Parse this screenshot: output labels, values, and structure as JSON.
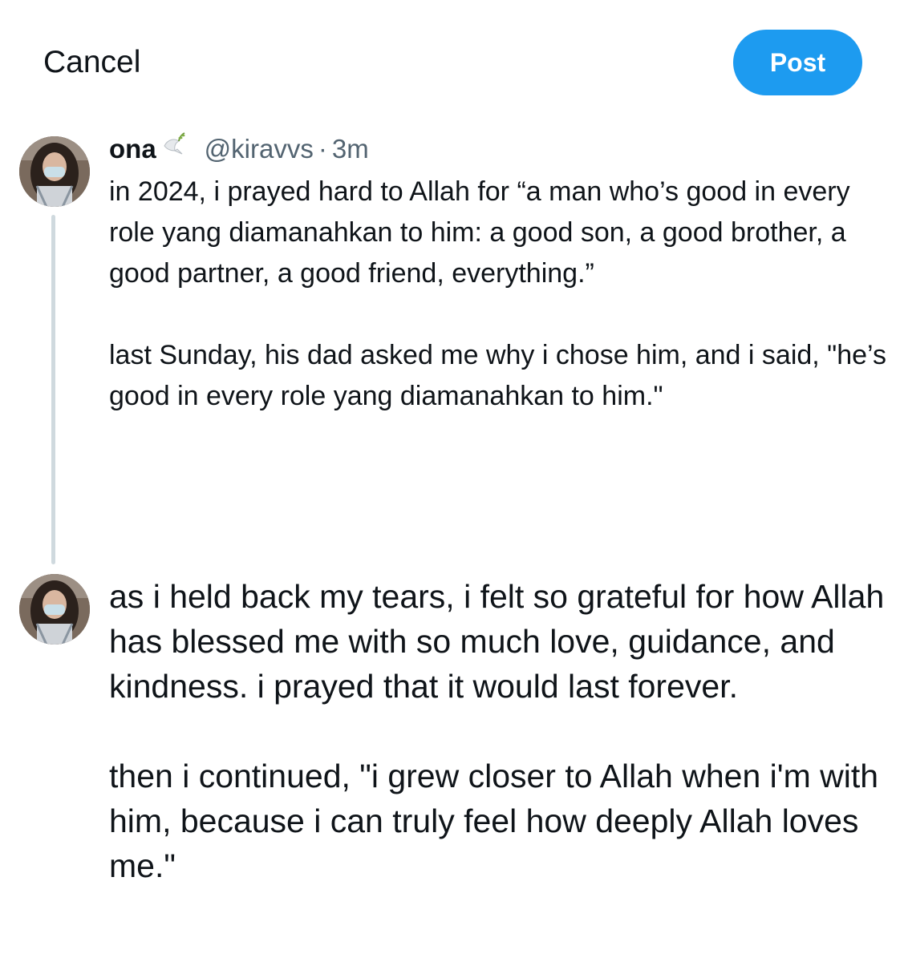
{
  "header": {
    "cancel_label": "Cancel",
    "post_label": "Post",
    "post_color": "#1d9bf0"
  },
  "thread": {
    "author": {
      "display_name": "ona",
      "emoji_icon": "dove-icon",
      "handle": "@kiravvs",
      "separator": "·",
      "time": "3m"
    },
    "tweets": [
      {
        "text": "in 2024, i prayed hard to Allah for “a man who’s good in every role yang diamanahkan to him: a good son, a good brother, a good partner, a good friend, everything.”\n\nlast Sunday, his dad asked me why i chose him, and i said, \"he’s good in every role yang diamanahkan to him.\""
      },
      {
        "text": "as i held back my tears, i felt so grateful for how Allah has blessed me with so much love, guidance, and kindness. i prayed that it would last forever.\n\nthen i continued, \"i grew closer to Allah when i'm with him, because i can truly feel how deeply Allah loves me.\""
      }
    ]
  }
}
